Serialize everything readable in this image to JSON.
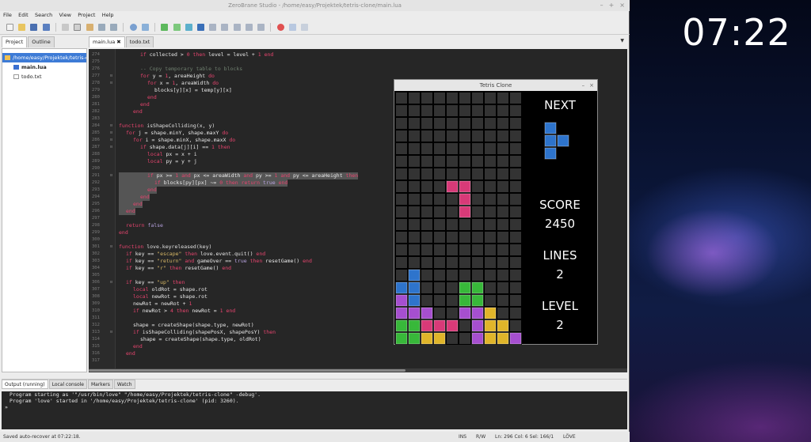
{
  "clock": "07:22",
  "window": {
    "title": "ZeroBrane Studio - /home/easy/Projektek/tetris-clone/main.lua"
  },
  "menu": [
    "File",
    "Edit",
    "Search",
    "View",
    "Project",
    "Help"
  ],
  "toolbar_icons": [
    "new-file-icon",
    "open-file-icon",
    "save-icon",
    "save-all-icon",
    "cut-icon",
    "copy-icon",
    "paste-icon",
    "undo-icon",
    "redo-icon",
    "find-icon",
    "replace-icon",
    "run-icon",
    "compile-icon",
    "debug-icon",
    "stop-icon",
    "step-into-icon",
    "step-over-icon",
    "step-out-icon",
    "run-to-cursor-icon",
    "toggle-breakpoint-icon",
    "breakpoint-icon",
    "stack-window-icon",
    "watch-window-icon"
  ],
  "left_panel": {
    "tabs": [
      "Project",
      "Outline"
    ],
    "root": "/home/easy/Projektek/tetris-c",
    "files": [
      "main.lua",
      "todo.txt"
    ]
  },
  "editor": {
    "tabs": [
      "main.lua",
      "todo.txt"
    ],
    "tab_close": "✖",
    "dropdown": "▼",
    "lines": [
      {
        "n": "274",
        "tokens": [
          [
            "k",
            "if "
          ],
          [
            "v",
            "collected > "
          ],
          [
            "n",
            "0"
          ],
          [
            "k",
            " then "
          ],
          [
            "v",
            "level = level + "
          ],
          [
            "n",
            "1"
          ],
          [
            "k",
            " end"
          ]
        ],
        "indent": 3,
        "fold": ""
      },
      {
        "n": "275",
        "tokens": [],
        "indent": 0,
        "fold": ""
      },
      {
        "n": "276",
        "tokens": [
          [
            "c",
            "-- Copy temporary table to blocks"
          ]
        ],
        "indent": 3,
        "fold": ""
      },
      {
        "n": "277",
        "tokens": [
          [
            "k",
            "for "
          ],
          [
            "v",
            "y = "
          ],
          [
            "n",
            "1"
          ],
          [
            "v",
            ", areaHeight "
          ],
          [
            "k",
            "do"
          ]
        ],
        "indent": 3,
        "fold": "⊟"
      },
      {
        "n": "278",
        "tokens": [
          [
            "k",
            "for "
          ],
          [
            "v",
            "x = "
          ],
          [
            "n",
            "1"
          ],
          [
            "v",
            ", areaWidth "
          ],
          [
            "k",
            "do"
          ]
        ],
        "indent": 4,
        "fold": "⊟"
      },
      {
        "n": "279",
        "tokens": [
          [
            "v",
            "blocks[y][x] = temp[y][x]"
          ]
        ],
        "indent": 5,
        "fold": ""
      },
      {
        "n": "280",
        "tokens": [
          [
            "k",
            "end"
          ]
        ],
        "indent": 4,
        "fold": ""
      },
      {
        "n": "281",
        "tokens": [
          [
            "k",
            "end"
          ]
        ],
        "indent": 3,
        "fold": ""
      },
      {
        "n": "282",
        "tokens": [
          [
            "k",
            "end"
          ]
        ],
        "indent": 2,
        "fold": ""
      },
      {
        "n": "283",
        "tokens": [],
        "indent": 0,
        "fold": ""
      },
      {
        "n": "284",
        "tokens": [
          [
            "k",
            "function "
          ],
          [
            "f",
            "isShapeColliding(x, y)"
          ]
        ],
        "indent": 0,
        "fold": "⊟"
      },
      {
        "n": "285",
        "tokens": [
          [
            "k",
            "for "
          ],
          [
            "v",
            "j = shape.minY, shape.maxY "
          ],
          [
            "k",
            "do"
          ]
        ],
        "indent": 1,
        "fold": "⊟"
      },
      {
        "n": "286",
        "tokens": [
          [
            "k",
            "for "
          ],
          [
            "v",
            "i = shape.minX, shape.maxX "
          ],
          [
            "k",
            "do"
          ]
        ],
        "indent": 2,
        "fold": "⊟"
      },
      {
        "n": "287",
        "tokens": [
          [
            "k",
            "if "
          ],
          [
            "v",
            "shape.data[j][i] == "
          ],
          [
            "n",
            "1"
          ],
          [
            "k",
            " then"
          ]
        ],
        "indent": 3,
        "fold": "⊟"
      },
      {
        "n": "288",
        "tokens": [
          [
            "k",
            "local "
          ],
          [
            "v",
            "px = x + i"
          ]
        ],
        "indent": 4,
        "fold": ""
      },
      {
        "n": "289",
        "tokens": [
          [
            "k",
            "local "
          ],
          [
            "v",
            "py = y + j"
          ]
        ],
        "indent": 4,
        "fold": ""
      },
      {
        "n": "290",
        "tokens": [],
        "indent": 0,
        "fold": ""
      },
      {
        "n": "291",
        "tokens": [
          [
            "k",
            "if "
          ],
          [
            "v",
            "px >= "
          ],
          [
            "n",
            "1"
          ],
          [
            "k",
            " and "
          ],
          [
            "v",
            "px <= areaWidth "
          ],
          [
            "k",
            "and "
          ],
          [
            "v",
            "py >= "
          ],
          [
            "n",
            "1"
          ],
          [
            "k",
            " and "
          ],
          [
            "v",
            "py <= areaHeight "
          ],
          [
            "k",
            "then"
          ]
        ],
        "indent": 4,
        "fold": "⊟",
        "hl": true
      },
      {
        "n": "292",
        "tokens": [
          [
            "k",
            "if "
          ],
          [
            "v",
            "blocks[py][px] ~= "
          ],
          [
            "n",
            "0"
          ],
          [
            "k",
            " then return "
          ],
          [
            "b",
            "true"
          ],
          [
            "k",
            " end"
          ]
        ],
        "indent": 5,
        "fold": "",
        "hl": true
      },
      {
        "n": "293",
        "tokens": [
          [
            "k",
            "end"
          ]
        ],
        "indent": 4,
        "fold": "",
        "hl": true
      },
      {
        "n": "294",
        "tokens": [
          [
            "k",
            "end"
          ]
        ],
        "indent": 3,
        "fold": "",
        "hl": true
      },
      {
        "n": "295",
        "tokens": [
          [
            "k",
            "end"
          ]
        ],
        "indent": 2,
        "fold": "",
        "hl": true
      },
      {
        "n": "296",
        "tokens": [
          [
            "k",
            "end"
          ]
        ],
        "indent": 1,
        "fold": "",
        "hl": true
      },
      {
        "n": "297",
        "tokens": [],
        "indent": 0,
        "fold": ""
      },
      {
        "n": "298",
        "tokens": [
          [
            "k",
            "return "
          ],
          [
            "b",
            "false"
          ]
        ],
        "indent": 1,
        "fold": ""
      },
      {
        "n": "299",
        "tokens": [
          [
            "k",
            "end"
          ]
        ],
        "indent": 0,
        "fold": ""
      },
      {
        "n": "300",
        "tokens": [],
        "indent": 0,
        "fold": ""
      },
      {
        "n": "301",
        "tokens": [
          [
            "k",
            "function "
          ],
          [
            "f",
            "love.keyreleased(key)"
          ]
        ],
        "indent": 0,
        "fold": "⊟"
      },
      {
        "n": "302",
        "tokens": [
          [
            "k",
            "if "
          ],
          [
            "v",
            "key == "
          ],
          [
            "s",
            "\"escape\""
          ],
          [
            "k",
            " then "
          ],
          [
            "v",
            "love.event.quit() "
          ],
          [
            "k",
            "end"
          ]
        ],
        "indent": 1,
        "fold": ""
      },
      {
        "n": "303",
        "tokens": [
          [
            "k",
            "if "
          ],
          [
            "v",
            "key == "
          ],
          [
            "s",
            "\"return\""
          ],
          [
            "k",
            " and "
          ],
          [
            "v",
            "gameOver == "
          ],
          [
            "b",
            "true"
          ],
          [
            "k",
            " then "
          ],
          [
            "v",
            "resetGame() "
          ],
          [
            "k",
            "end"
          ]
        ],
        "indent": 1,
        "fold": ""
      },
      {
        "n": "304",
        "tokens": [
          [
            "k",
            "if "
          ],
          [
            "v",
            "key == "
          ],
          [
            "s",
            "\"r\""
          ],
          [
            "k",
            " then "
          ],
          [
            "v",
            "resetGame() "
          ],
          [
            "k",
            "end"
          ]
        ],
        "indent": 1,
        "fold": ""
      },
      {
        "n": "305",
        "tokens": [],
        "indent": 0,
        "fold": ""
      },
      {
        "n": "306",
        "tokens": [
          [
            "k",
            "if "
          ],
          [
            "v",
            "key == "
          ],
          [
            "s",
            "\"up\""
          ],
          [
            "k",
            " then"
          ]
        ],
        "indent": 1,
        "fold": "⊟"
      },
      {
        "n": "307",
        "tokens": [
          [
            "k",
            "local "
          ],
          [
            "v",
            "oldRot = shape.rot"
          ]
        ],
        "indent": 2,
        "fold": ""
      },
      {
        "n": "308",
        "tokens": [
          [
            "k",
            "local "
          ],
          [
            "v",
            "newRot = shape.rot"
          ]
        ],
        "indent": 2,
        "fold": ""
      },
      {
        "n": "309",
        "tokens": [
          [
            "v",
            "newRot = newRot + "
          ],
          [
            "n",
            "1"
          ]
        ],
        "indent": 2,
        "fold": ""
      },
      {
        "n": "310",
        "tokens": [
          [
            "k",
            "if "
          ],
          [
            "v",
            "newRot > "
          ],
          [
            "n",
            "4"
          ],
          [
            "k",
            " then "
          ],
          [
            "v",
            "newRot = "
          ],
          [
            "n",
            "1"
          ],
          [
            "k",
            " end"
          ]
        ],
        "indent": 2,
        "fold": ""
      },
      {
        "n": "311",
        "tokens": [],
        "indent": 0,
        "fold": ""
      },
      {
        "n": "312",
        "tokens": [
          [
            "v",
            "shape = createShape(shape.type, newRot)"
          ]
        ],
        "indent": 2,
        "fold": ""
      },
      {
        "n": "313",
        "tokens": [
          [
            "k",
            "if "
          ],
          [
            "v",
            "isShapeColliding(shapePosX, shapePosY) "
          ],
          [
            "k",
            "then"
          ]
        ],
        "indent": 2,
        "fold": "⊟"
      },
      {
        "n": "314",
        "tokens": [
          [
            "v",
            "shape = createShape(shape.type, oldRot)"
          ]
        ],
        "indent": 3,
        "fold": ""
      },
      {
        "n": "315",
        "tokens": [
          [
            "k",
            "end"
          ]
        ],
        "indent": 2,
        "fold": ""
      },
      {
        "n": "316",
        "tokens": [
          [
            "k",
            "end"
          ]
        ],
        "indent": 1,
        "fold": ""
      },
      {
        "n": "317",
        "tokens": [],
        "indent": 0,
        "fold": ""
      }
    ]
  },
  "tetris": {
    "title": "Tetris Clone",
    "controls": [
      "–",
      "×"
    ],
    "next_label": "NEXT",
    "score_label": "SCORE",
    "score": "2450",
    "lines_label": "LINES",
    "lines": "2",
    "level_label": "LEVEL",
    "level": "2",
    "colors": {
      "blue": "#2e74cc",
      "pink": "#d83a78",
      "purple": "#a64fcf",
      "green": "#38b83a",
      "yellow": "#e0b52a",
      "grid": "#333333"
    },
    "board_rows": [
      "..........",
      "..........",
      "..........",
      "..........",
      "..........",
      "..........",
      "....PP....",
      ".....P....",
      ".....P....",
      "..........",
      "..........",
      "..........",
      "..........",
      ".B........",
      "BB...GG...",
      "UB...GG...",
      "UUU..UUY..",
      "GGPPP.UYY.",
      "GGYY..UYYU"
    ],
    "next_piece": [
      "B.",
      "BB",
      "B."
    ]
  },
  "output": {
    "tabs": [
      "Output (running)",
      "Local console",
      "Markers",
      "Watch"
    ],
    "lines": [
      {
        "text": "Program starting as '\"/usr/bin/love\" \"/home/easy/Projektek/tetris-clone\" -debug'."
      },
      {
        "text": "Program 'love' started in '/home/easy/Projektek/tetris-clone' (pid: 3260)."
      },
      {
        "text": "»"
      }
    ]
  },
  "status": {
    "message": "Saved auto-recover at 07:22:18.",
    "mode": "INS",
    "access": "R/W",
    "position": "Ln: 296 Col: 6 Sel: 166/1",
    "interpreter": "LÖVE"
  }
}
